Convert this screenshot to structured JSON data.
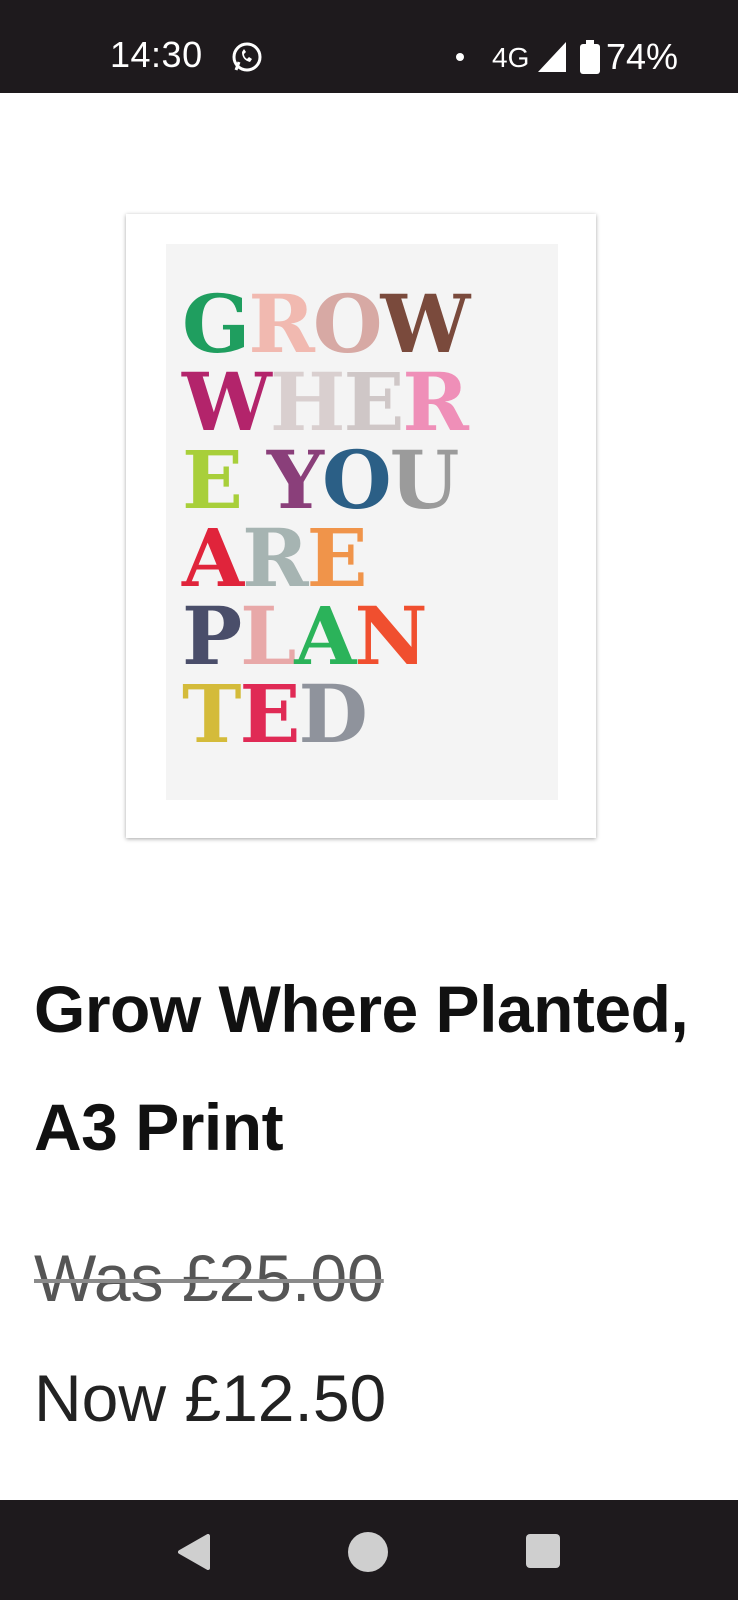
{
  "status_bar": {
    "time": "14:30",
    "network": "4G",
    "battery_percent": "74%",
    "icons": [
      "whatsapp-icon",
      "notification-dot-icon",
      "signal-icon",
      "battery-icon"
    ]
  },
  "product": {
    "image_text_lines": [
      {
        "letters": [
          {
            "t": "G",
            "c": "#1f9e5f"
          },
          {
            "t": "R",
            "c": "#f1b9b0"
          },
          {
            "t": "O",
            "c": "#d7a9a4"
          },
          {
            "t": "W",
            "c": "#7a4a3c"
          }
        ]
      },
      {
        "letters": [
          {
            "t": "W",
            "c": "#b3246b"
          },
          {
            "t": "H",
            "c": "#d9cfcf"
          },
          {
            "t": "E",
            "c": "#cfc7c7"
          },
          {
            "t": "R",
            "c": "#ef8fb8"
          }
        ]
      },
      {
        "letters": [
          {
            "t": "E",
            "c": "#a8cf3a"
          },
          {
            "t": " ",
            "c": "#000000"
          },
          {
            "t": "Y",
            "c": "#8a3f7a"
          },
          {
            "t": "O",
            "c": "#2b5f86"
          },
          {
            "t": "U",
            "c": "#9b9b9b"
          }
        ]
      },
      {
        "letters": [
          {
            "t": "A",
            "c": "#e0243b"
          },
          {
            "t": "R",
            "c": "#a6b4b2"
          },
          {
            "t": "E",
            "c": "#f0944a"
          }
        ]
      },
      {
        "letters": [
          {
            "t": "P",
            "c": "#4a4e6a"
          },
          {
            "t": "L",
            "c": "#e8a8a8"
          },
          {
            "t": "A",
            "c": "#2bb35a"
          },
          {
            "t": "N",
            "c": "#f04f2f"
          }
        ]
      },
      {
        "letters": [
          {
            "t": "T",
            "c": "#d4bb3a"
          },
          {
            "t": "E",
            "c": "#e02a55"
          },
          {
            "t": "D",
            "c": "#8f939c"
          }
        ]
      }
    ],
    "title": "Grow Where Planted, A3 Print",
    "was_price": "Was £25.00",
    "now_price": "Now £12.50"
  },
  "nav_bar": {
    "icons": [
      "back-icon",
      "home-icon",
      "recents-icon"
    ]
  }
}
